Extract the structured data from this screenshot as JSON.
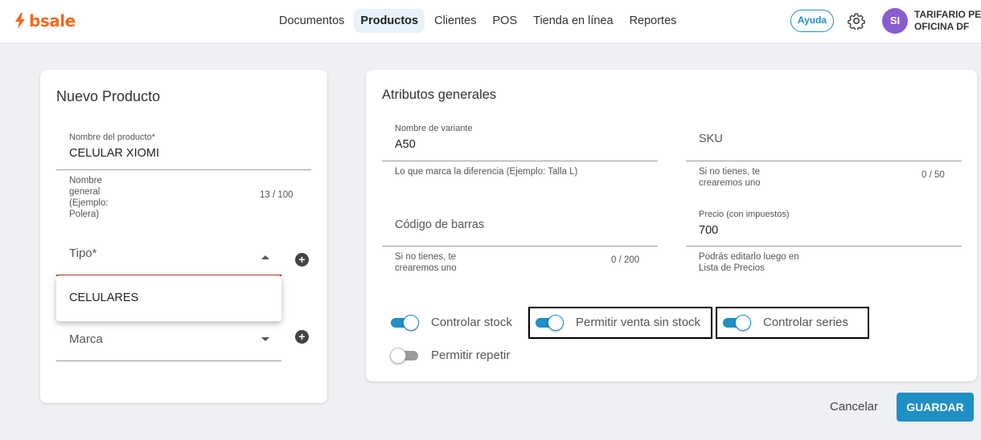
{
  "brand": {
    "name": "bsale",
    "color": "#f26a1b"
  },
  "nav": {
    "items": [
      "Documentos",
      "Productos",
      "Clientes",
      "POS",
      "Tienda en línea",
      "Reportes"
    ],
    "active": "Productos"
  },
  "header": {
    "help_label": "Ayuda",
    "avatar_initials": "SI",
    "user_line1": "TARIFARIO PER",
    "user_line2": "OFICINA DF"
  },
  "left_card": {
    "title": "Nuevo Producto",
    "name_field": {
      "label": "Nombre del producto*",
      "value": "CELULAR XIOMI",
      "hint_lines": [
        "Nombre",
        "general",
        "(Ejemplo:",
        "Polera)"
      ],
      "count": "13 / 100"
    },
    "tipo_field": {
      "placeholder": "Tipo*",
      "options": [
        "CELULARES"
      ]
    },
    "marca_field": {
      "placeholder": "Marca"
    }
  },
  "right_card": {
    "title": "Atributos generales",
    "variant_field": {
      "label": "Nombre de variante",
      "value": "A50",
      "hint": "Lo que marca la diferencia (Ejemplo: Talla L)"
    },
    "sku_field": {
      "placeholder": "SKU",
      "hint_lines": [
        "Si no tienes, te",
        "crearemos uno"
      ],
      "count": "0 / 50"
    },
    "barcode_field": {
      "placeholder": "Código de barras",
      "hint_lines": [
        "Si no tienes, te",
        "crearemos uno"
      ],
      "count": "0 / 200"
    },
    "price_field": {
      "label": "Precio (con impuestos)",
      "value": "700",
      "hint_lines": [
        "Podrás editarlo luego en",
        "Lista de Precios"
      ]
    },
    "toggles": {
      "controlar_stock": {
        "label": "Controlar stock",
        "on": true
      },
      "permitir_venta_sin_stock": {
        "label": "Permitir venta sin stock",
        "on": true
      },
      "controlar_series": {
        "label": "Controlar series",
        "on": true
      },
      "permitir_repetir": {
        "label": "Permitir repetir",
        "on": false
      }
    }
  },
  "actions": {
    "cancel_label": "Cancelar",
    "save_label": "GUARDAR"
  },
  "colors": {
    "accent": "#1f8fc5",
    "avatar": "#8a5cd0",
    "focus_line": "#c0392b"
  }
}
